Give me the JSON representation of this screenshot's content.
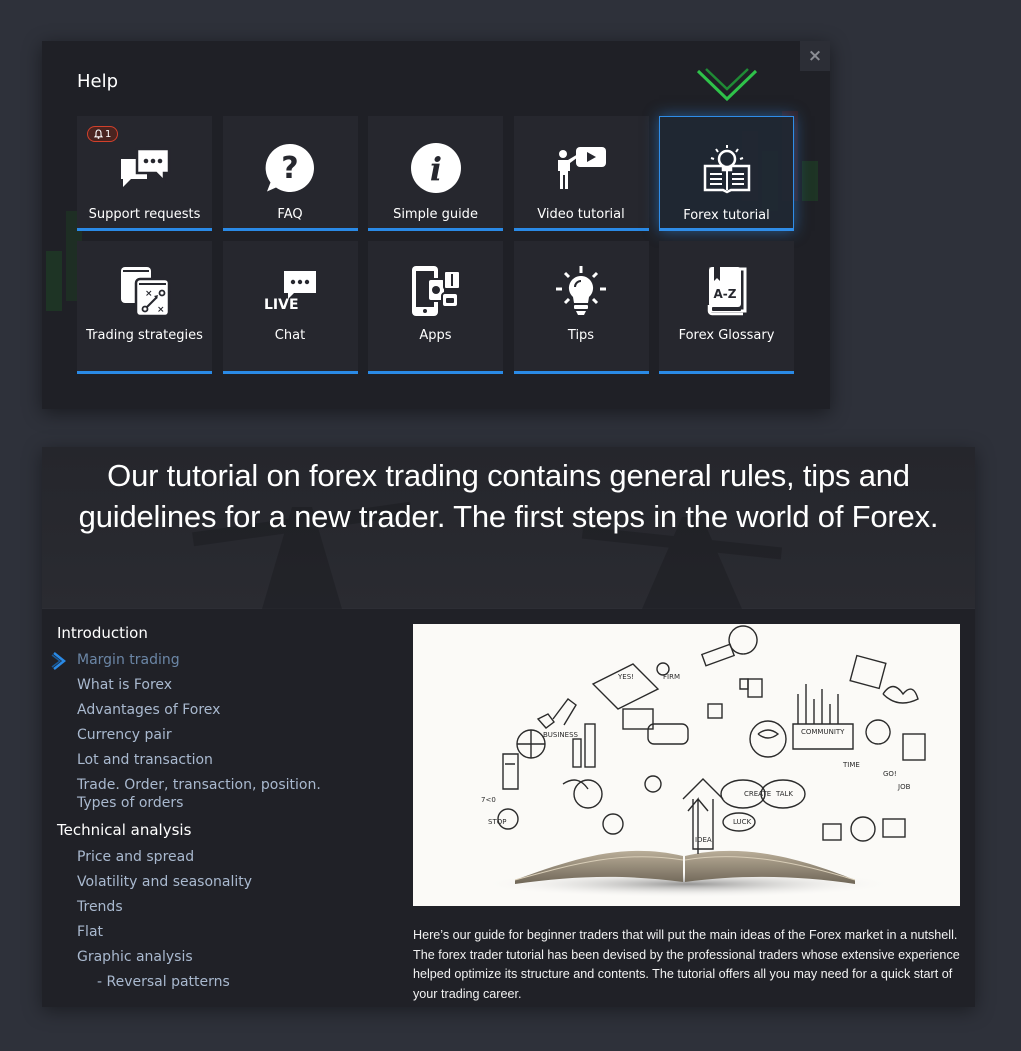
{
  "help": {
    "title": "Help",
    "close_label": "×",
    "tiles": [
      {
        "label": "Support requests",
        "icon": "chat-bubbles-icon",
        "badge": "1"
      },
      {
        "label": "FAQ",
        "icon": "question-bubble-icon"
      },
      {
        "label": "Simple guide",
        "icon": "info-circle-icon"
      },
      {
        "label": "Video tutorial",
        "icon": "presenter-video-icon"
      },
      {
        "label": "Forex tutorial",
        "icon": "lightbulb-book-icon",
        "active": true
      },
      {
        "label": "Trading strategies",
        "icon": "strategy-board-icon"
      },
      {
        "label": "Chat",
        "icon": "live-chat-icon",
        "icon_text": "LIVE"
      },
      {
        "label": "Apps",
        "icon": "mobile-apps-icon"
      },
      {
        "label": "Tips",
        "icon": "lightbulb-icon"
      },
      {
        "label": "Forex Glossary",
        "icon": "glossary-book-icon",
        "icon_text": "A-Z"
      }
    ],
    "colors": {
      "accent": "#2a8ae6",
      "badge": "#d2402b",
      "pointer": "#2fc24a"
    }
  },
  "tutorial": {
    "headline": "Our tutorial on forex trading contains general rules, tips and guidelines for a new trader. The first steps in the world of Forex.",
    "toc": [
      {
        "type": "section",
        "label": "Introduction"
      },
      {
        "type": "item",
        "label": "Margin trading",
        "active": true
      },
      {
        "type": "item",
        "label": "What is Forex"
      },
      {
        "type": "item",
        "label": "Advantages of Forex"
      },
      {
        "type": "item",
        "label": "Currency pair"
      },
      {
        "type": "item",
        "label": "Lot and transaction"
      },
      {
        "type": "item",
        "label": "Trade. Order, transaction, position. Types of orders"
      },
      {
        "type": "section",
        "label": "Technical analysis"
      },
      {
        "type": "item",
        "label": "Price and spread"
      },
      {
        "type": "item",
        "label": "Volatility and seasonality"
      },
      {
        "type": "item",
        "label": "Trends"
      },
      {
        "type": "item",
        "label": "Flat"
      },
      {
        "type": "item",
        "label": "Graphic analysis"
      },
      {
        "type": "sub",
        "label": "-  Reversal patterns"
      }
    ],
    "image_alt": "Open book with hand-drawn business doodles",
    "doodle_words": [
      "BUSINESS",
      "COMMUNITY",
      "CREATE",
      "TALK",
      "LUCK",
      "IDEA",
      "GO!",
      "JOB",
      "TIME",
      "STOP",
      "7<0",
      "FIRM",
      "YES!"
    ],
    "intro": "Here’s our guide for beginner traders that will put the main ideas of the Forex market in a nutshell. The forex trader tutorial has been devised by the professional traders whose extensive experience helped optimize its structure and contents. The tutorial offers all you may need for a quick start of your trading career."
  }
}
